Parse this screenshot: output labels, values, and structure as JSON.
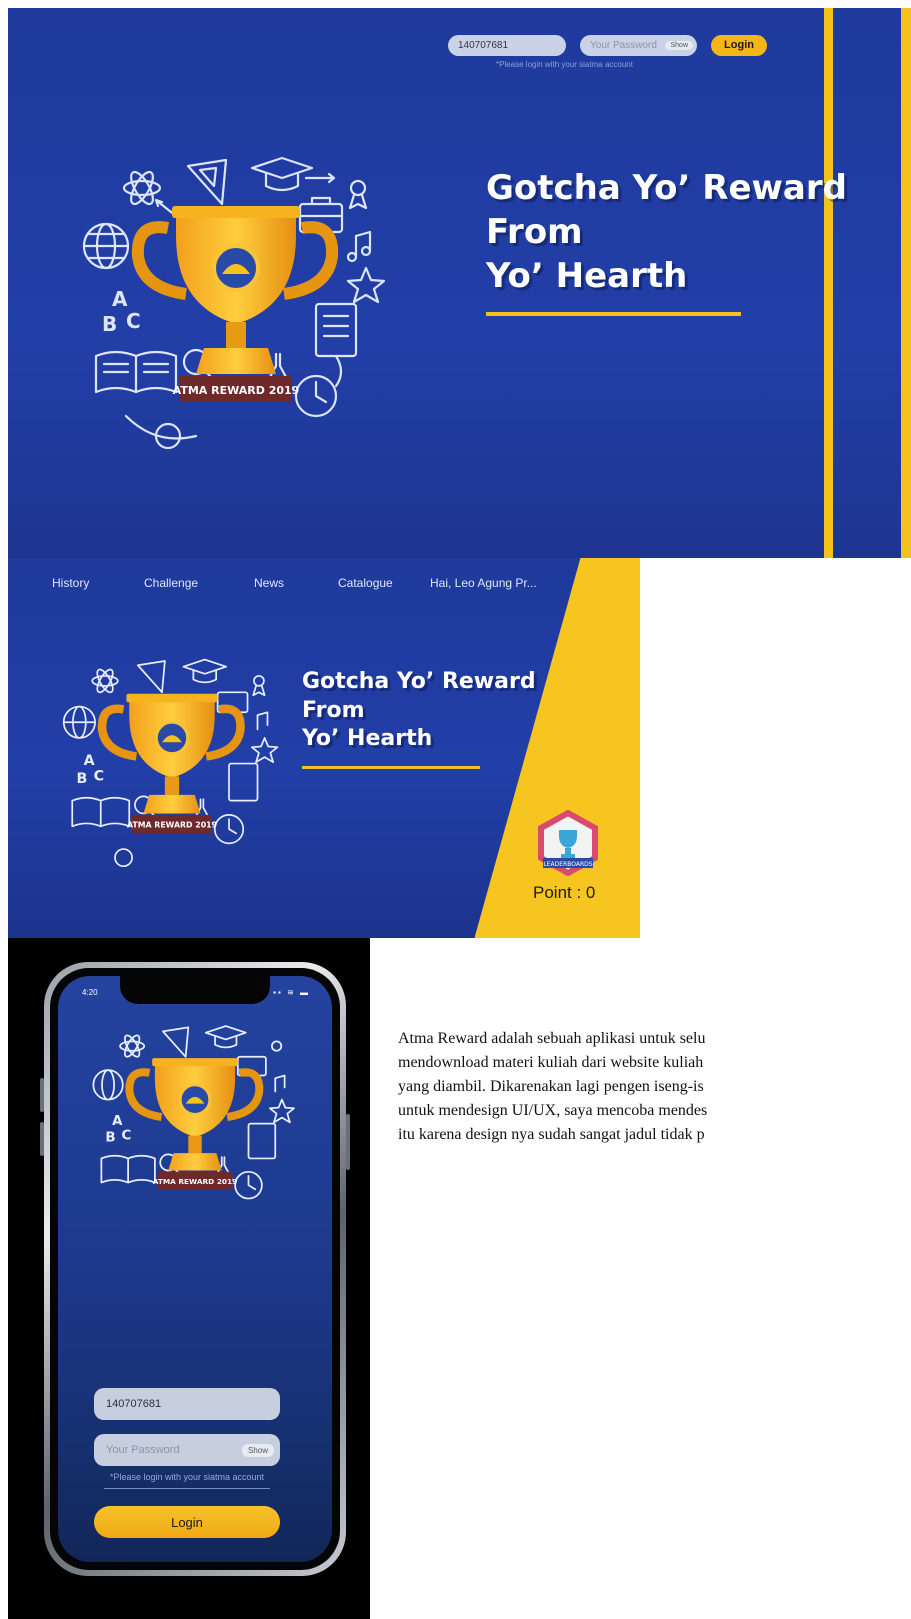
{
  "desktop_login": {
    "user_id": "140707681",
    "password_placeholder": "Your Password",
    "show_label": "Show",
    "login_label": "Login",
    "hint": "*Please login with your siatma account",
    "headline": [
      "Gotcha Yo’ Reward",
      "From",
      "Yo’ Hearth"
    ],
    "trophy_banner": "ATMA REWARD 2019"
  },
  "dashboard": {
    "nav": [
      "History",
      "Challenge",
      "News",
      "Catalogue",
      "Hai, Leo Agung Pr..."
    ],
    "headline": [
      "Gotcha Yo’ Reward",
      "From",
      "Yo’ Hearth"
    ],
    "trophy_banner": "ATMA REWARD 2019",
    "badge_label": "LEADERBOARDS",
    "points": "Point : 0"
  },
  "mobile_login": {
    "status_time": "4:20",
    "status_icons": "▪▪ ≋ ▬",
    "trophy_banner": "ATMA REWARD 2019",
    "user_id": "140707681",
    "password_placeholder": "Your Password",
    "show_label": "Show",
    "hint": "*Please login with your siatma account",
    "login_label": "Login"
  },
  "description": {
    "lines": [
      "Atma Reward adalah sebuah aplikasi untuk selu",
      "mendownload materi kuliah dari website kuliah",
      "yang diambil. Dikarenakan lagi pengen iseng-is",
      "untuk mendesign UI/UX, saya mencoba mendes",
      "itu karena design nya sudah sangat jadul tidak p"
    ]
  },
  "colors": {
    "navy": "#1f3a9c",
    "yellow": "#f5c21c",
    "gold": "#f5b716",
    "banner_maroon": "#6e2a2a"
  }
}
